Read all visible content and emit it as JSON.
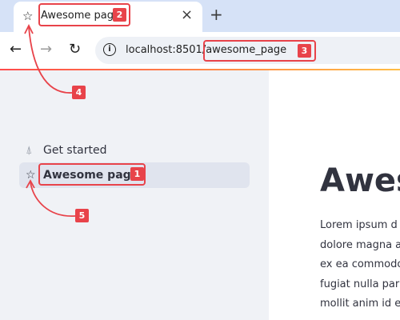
{
  "browser": {
    "tab": {
      "star_icon": "star-icon",
      "title": "Awesome page",
      "close_icon": "close-icon"
    },
    "new_tab_icon": "plus-icon",
    "nav": {
      "back_icon": "arrow-left-icon",
      "forward_icon": "arrow-right-icon",
      "reload_icon": "reload-icon"
    },
    "url": {
      "host": "localhost:8501/",
      "path": "awesome_page"
    }
  },
  "sidebar": {
    "items": [
      {
        "label": "Get started",
        "icon": "rocket-icon",
        "active": false
      },
      {
        "label": "Awesome page",
        "icon": "star-icon",
        "active": true
      }
    ]
  },
  "main": {
    "heading": "Awes",
    "paragraph_lines": [
      "Lorem ipsum d",
      "dolore magna a",
      "ex ea commodo",
      "fugiat nulla par",
      "mollit anim id e"
    ]
  },
  "annotations": {
    "numbers": [
      "1",
      "2",
      "3",
      "4",
      "5"
    ],
    "color": "#e8434a"
  },
  "colors": {
    "accent_start": "#ff4b4b",
    "accent_end": "#ffbd45",
    "sidebar_bg": "#f0f2f6"
  }
}
